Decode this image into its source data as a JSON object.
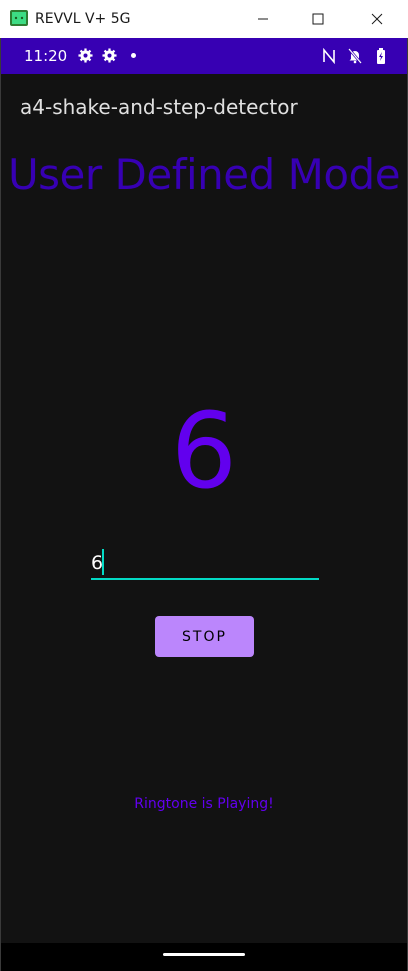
{
  "window": {
    "title": "REVVL V+ 5G",
    "icons": {
      "app": "android-emulator-icon",
      "minimize": "minimize-icon",
      "maximize": "maximize-icon",
      "close": "close-icon"
    }
  },
  "status_bar": {
    "time": "11:20",
    "color": "#3700b3",
    "icons": [
      "gear-icon",
      "gear-icon",
      "dot-icon",
      "nfc-icon",
      "notifications-off-icon",
      "battery-icon"
    ]
  },
  "app": {
    "title": "a4-shake-and-step-detector",
    "mode_title": "User Defined Mode",
    "counter": "6",
    "input_value": "6",
    "stop_label": "STOP",
    "status_message": "Ringtone is Playing!"
  },
  "colors": {
    "primary_dark": "#3700b3",
    "primary": "#6200ee",
    "button": "#bb86fc",
    "accent": "#03dac5",
    "background": "#121212"
  }
}
